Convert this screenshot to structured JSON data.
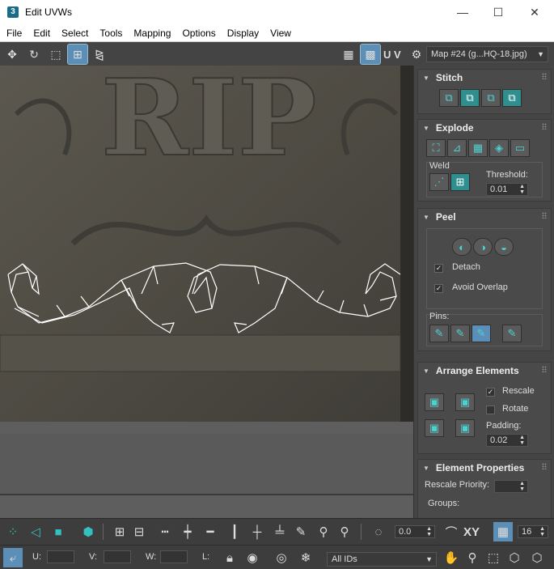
{
  "window": {
    "title": "Edit UVWs",
    "app_badge": "3",
    "minimize": "—",
    "maximize": "☐",
    "close": "✕"
  },
  "menu": [
    "File",
    "Edit",
    "Select",
    "Tools",
    "Mapping",
    "Options",
    "Display",
    "View"
  ],
  "toolbar": {
    "uv_label": "U V",
    "map_select": "Map #24 (g...HQ-18.jpg)"
  },
  "viewport": {
    "stone_text": "RIP"
  },
  "stitch": {
    "title": "Stitch"
  },
  "explode": {
    "title": "Explode",
    "weld_label": "Weld",
    "threshold_label": "Threshold:",
    "threshold_value": "0.01"
  },
  "peel": {
    "title": "Peel",
    "detach_label": "Detach",
    "avoid_overlap_label": "Avoid Overlap",
    "pins_label": "Pins:"
  },
  "arrange": {
    "title": "Arrange Elements",
    "rescale_label": "Rescale",
    "rotate_label": "Rotate",
    "padding_label": "Padding:",
    "padding_value": "0.02"
  },
  "element_props": {
    "title": "Element Properties",
    "rescale_priority_label": "Rescale Priority:",
    "groups_label": "Groups:"
  },
  "bottom": {
    "angle_value": "0.0",
    "xy_label": "XY",
    "grid_value": "16",
    "u_label": "U:",
    "v_label": "V:",
    "w_label": "W:",
    "l_label": "L:",
    "ids_select": "All IDs"
  },
  "colors": {
    "accent": "#35c0c0",
    "highlight": "#5c8fb8"
  }
}
